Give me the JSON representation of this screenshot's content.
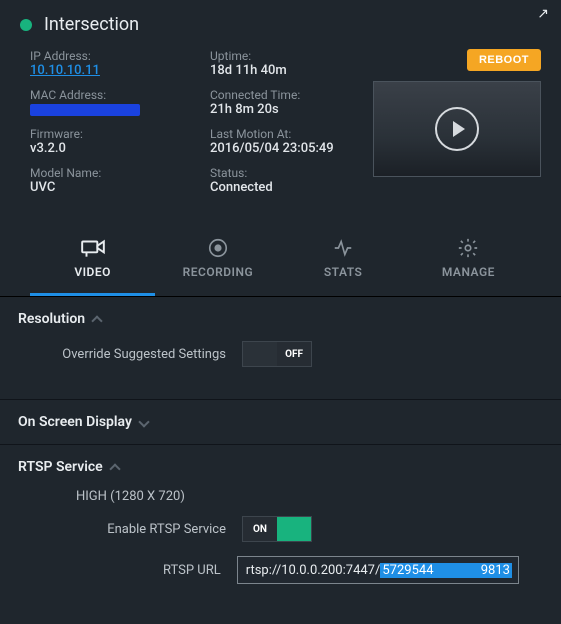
{
  "header": {
    "title": "Intersection"
  },
  "info": {
    "ip_label": "IP Address:",
    "ip_value": "10.10.10.11",
    "mac_label": "MAC Address:",
    "firmware_label": "Firmware:",
    "firmware_value": "v3.2.0",
    "model_label": "Model Name:",
    "model_value": "UVC",
    "uptime_label": "Uptime:",
    "uptime_value": "18d 11h 40m",
    "connected_label": "Connected Time:",
    "connected_value": "21h 8m 20s",
    "lastmotion_label": "Last Motion At:",
    "lastmotion_value": "2016/05/04 23:05:49",
    "status_label": "Status:",
    "status_value": "Connected"
  },
  "actions": {
    "reboot": "REBOOT"
  },
  "tabs": {
    "video": "VIDEO",
    "recording": "RECORDING",
    "stats": "STATS",
    "manage": "MANAGE"
  },
  "sections": {
    "resolution": {
      "title": "Resolution",
      "override_label": "Override Suggested Settings",
      "override_state": "OFF"
    },
    "osd": {
      "title": "On Screen Display"
    },
    "rtsp": {
      "title": "RTSP Service",
      "preset": "HIGH (1280 X 720)",
      "enable_label": "Enable RTSP Service",
      "enable_state": "ON",
      "url_label": "RTSP URL",
      "url_prefix": "rtsp://10.0.0.200:7447/",
      "url_mid": "5729544",
      "url_suffix": "9813"
    }
  }
}
